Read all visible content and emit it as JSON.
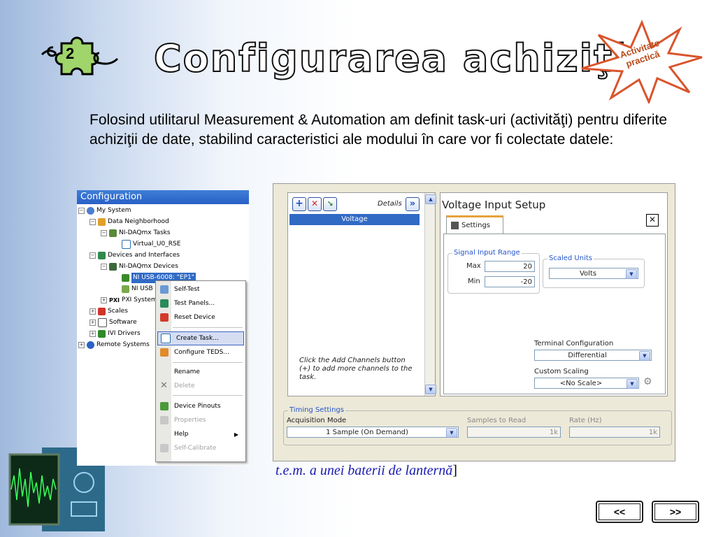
{
  "slide": {
    "title": "Configurarea achiziţiei",
    "puzzle_number": "2",
    "badge": "Activitate practică",
    "intro": "Folosind utilitarul Measurement  &  Automation am definit task-uri (activităţi) pentru diferite achiziţii de date, stabilind caracteristici ale modului în care vor fi colectate datele:",
    "caption_italic": "t.e.m. a unei baterii de lanternă",
    "caption_bracket": "]",
    "nav_prev": "<<",
    "nav_next": ">>"
  },
  "config_panel": {
    "title": "Configuration",
    "tree": [
      {
        "label": "My System"
      },
      {
        "label": "Data Neighborhood"
      },
      {
        "label": "NI-DAQmx Tasks"
      },
      {
        "label": "Virtual_U0_RSE"
      },
      {
        "label": "Devices and Interfaces"
      },
      {
        "label": "NI-DAQmx Devices"
      },
      {
        "label": "NI USB-6008: \"EP1\""
      },
      {
        "label": "NI USB"
      },
      {
        "label": "PXI System"
      },
      {
        "label": "Scales"
      },
      {
        "label": "Software"
      },
      {
        "label": "IVI Drivers"
      },
      {
        "label": "Remote Systems"
      }
    ],
    "context_menu": [
      {
        "label": "Self-Test"
      },
      {
        "label": "Test Panels..."
      },
      {
        "label": "Reset Device"
      },
      {
        "label": "Create Task..."
      },
      {
        "label": "Configure TEDS..."
      },
      {
        "label": "Rename"
      },
      {
        "label": "Delete"
      },
      {
        "label": "Device Pinouts"
      },
      {
        "label": "Properties"
      },
      {
        "label": "Help"
      },
      {
        "label": "Self-Calibrate"
      }
    ]
  },
  "voltage_panel": {
    "details_label": "Details",
    "details_btn": "»",
    "channel": "Voltage",
    "add_hint": "Click the Add Channels button (+) to add more channels to the task.",
    "setup_title": "Voltage Input Setup",
    "settings_tab": "Settings",
    "signal_range_label": "Signal Input Range",
    "max_label": "Max",
    "max_value": "20",
    "min_label": "Min",
    "min_value": "-20",
    "scaled_units_label": "Scaled Units",
    "scaled_units_value": "Volts",
    "terminal_label": "Terminal Configuration",
    "terminal_value": "Differential",
    "custom_scaling_label": "Custom Scaling",
    "custom_scaling_value": "<No Scale>",
    "timing_label": "Timing Settings",
    "acq_mode_label": "Acquisition Mode",
    "acq_mode_value": "1 Sample (On Demand)",
    "samples_label": "Samples to Read",
    "samples_value": "1k",
    "rate_label": "Rate (Hz)",
    "rate_value": "1k"
  }
}
